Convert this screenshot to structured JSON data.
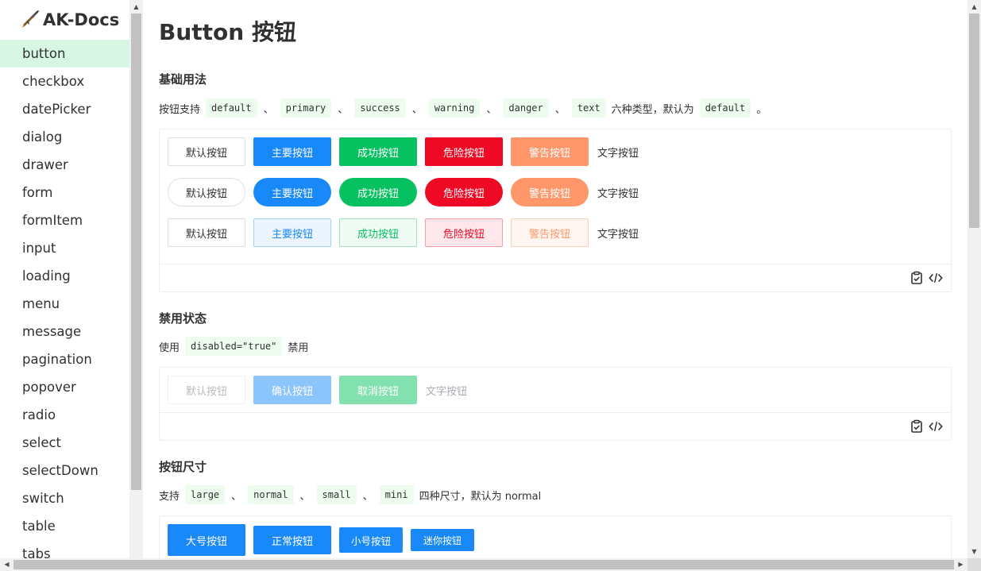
{
  "app": {
    "name": "AK-Docs",
    "logo_icon": "rifle-icon"
  },
  "sidebar": {
    "items": [
      {
        "label": "button",
        "active": true
      },
      {
        "label": "checkbox"
      },
      {
        "label": "datePicker"
      },
      {
        "label": "dialog"
      },
      {
        "label": "drawer"
      },
      {
        "label": "form"
      },
      {
        "label": "formItem"
      },
      {
        "label": "input"
      },
      {
        "label": "loading"
      },
      {
        "label": "menu"
      },
      {
        "label": "message"
      },
      {
        "label": "pagination"
      },
      {
        "label": "popover"
      },
      {
        "label": "radio"
      },
      {
        "label": "select"
      },
      {
        "label": "selectDown"
      },
      {
        "label": "switch"
      },
      {
        "label": "table"
      },
      {
        "label": "tabs"
      }
    ]
  },
  "page": {
    "title": "Button 按钮"
  },
  "basic": {
    "title": "基础用法",
    "desc_prefix": "按钮支持",
    "codes": [
      "default",
      "primary",
      "success",
      "warning",
      "danger",
      "text"
    ],
    "separator": "、",
    "desc_mid": "六种类型，默认为",
    "default_code": "default",
    "desc_end": "。",
    "labels": {
      "default": "默认按钮",
      "primary": "主要按钮",
      "success": "成功按钮",
      "danger": "危险按钮",
      "warning": "警告按钮",
      "text": "文字按钮"
    }
  },
  "disabled": {
    "title": "禁用状态",
    "desc_prefix": "使用",
    "code": "disabled=\"true\"",
    "desc_suffix": "禁用",
    "labels": {
      "default": "默认按钮",
      "confirm": "确认按钮",
      "cancel": "取消按钮",
      "text": "文字按钮"
    }
  },
  "sizes": {
    "title": "按钮尺寸",
    "desc_prefix": "支持",
    "codes": [
      "large",
      "normal",
      "small",
      "mini"
    ],
    "separator": "、",
    "desc_suffix": "四种尺寸，默认为 normal",
    "labels": {
      "large": "大号按钮",
      "normal": "正常按钮",
      "small": "小号按钮",
      "mini": "迷你按钮"
    }
  },
  "toolbar": {
    "copy_icon": "clipboard-check-icon",
    "code_icon": "code-icon"
  },
  "colors": {
    "primary": "#1989fa",
    "success": "#07c160",
    "danger": "#ee0a24",
    "warning": "#ff976a",
    "active_nav_bg": "#d7f7e4",
    "code_bg": "#eefcf0"
  }
}
